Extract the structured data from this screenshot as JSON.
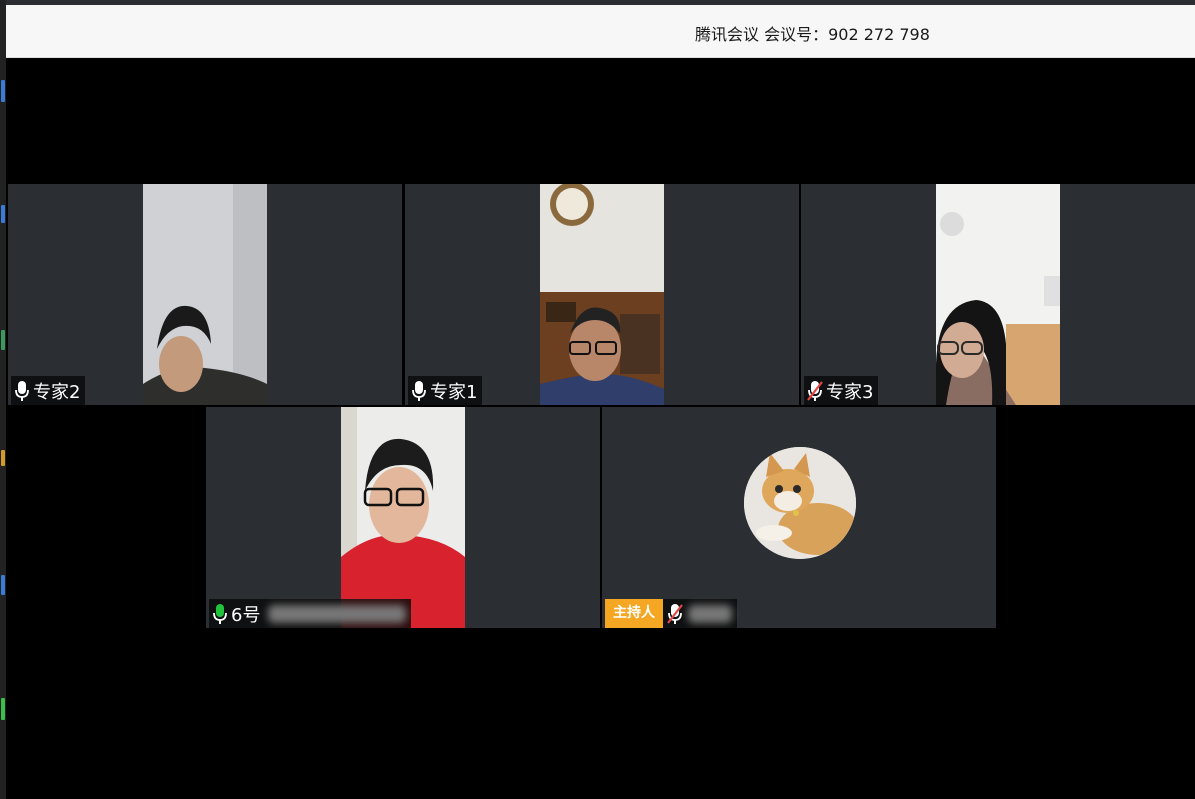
{
  "window": {
    "title": "腾讯会议 会议号：902 272 798"
  },
  "participants": [
    {
      "id": "p1",
      "name": "专家2",
      "mic": "on",
      "host": false
    },
    {
      "id": "p2",
      "name": "专家1",
      "mic": "on",
      "host": false
    },
    {
      "id": "p3",
      "name": "专家3",
      "mic": "muted",
      "host": false
    },
    {
      "id": "p4",
      "name": "6号",
      "mic": "speaking",
      "host": false
    },
    {
      "id": "p5",
      "name": "",
      "mic": "muted",
      "host": true,
      "host_label": "主持人",
      "avatar": "cat-avatar"
    }
  ],
  "colors": {
    "tile_bg": "#2b2e32",
    "host_badge": "#f5a623",
    "mic_speaking": "#22c33d",
    "mic_muted": "#e64545"
  }
}
